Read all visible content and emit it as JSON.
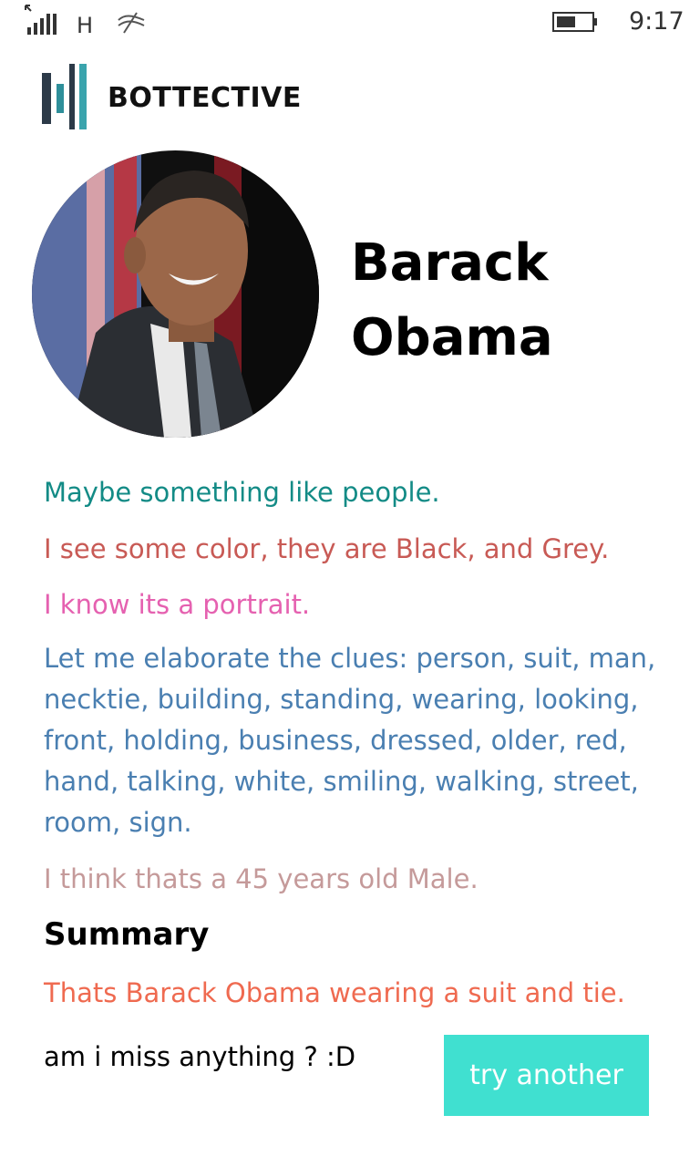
{
  "status_bar": {
    "network_type": "H",
    "time": "9:17",
    "icons": [
      "signal-icon",
      "wifi-icon",
      "battery-icon"
    ]
  },
  "header": {
    "app_name": "BOTTECTIVE",
    "logo_icon": "bar-logo-icon"
  },
  "profile": {
    "name": "Barack Obama"
  },
  "clues": [
    {
      "text": "Maybe something like people.",
      "color": "#138b86"
    },
    {
      "text": "I see some color, they are Black, and Grey.",
      "color": "#c85a55"
    },
    {
      "text": "I know its a portrait.",
      "color": "#e561b0"
    },
    {
      "text": "Let me elaborate the clues: person, suit, man, necktie, building, standing, wearing, looking, front, holding, business, dressed, older, red, hand, talking, white, smiling, walking, street, room, sign.",
      "color": "#4a7fb1"
    },
    {
      "text": "I think thats a 45 years old Male.",
      "color": "#c59a9a"
    }
  ],
  "summary": {
    "title": "Summary",
    "text": "Thats Barack Obama wearing a suit and tie.",
    "color": "#ef6a50"
  },
  "footer": {
    "question": "am i miss anything ? :D",
    "button_label": "try another",
    "button_color": "#40e0d0"
  }
}
